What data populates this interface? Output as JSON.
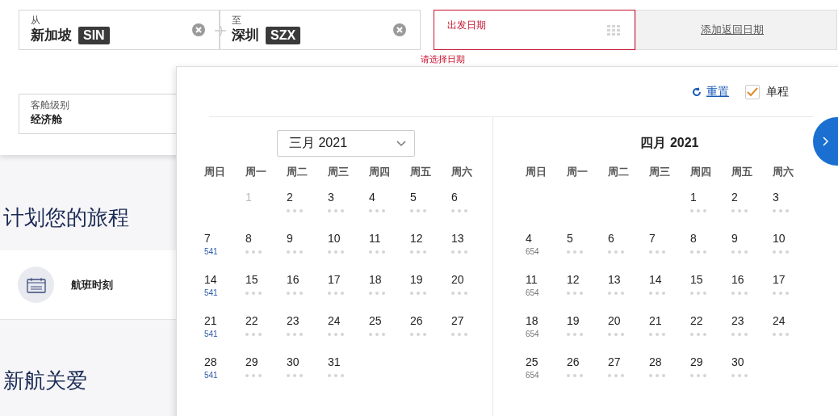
{
  "trip_form": {
    "origin": {
      "label": "从",
      "city": "新加坡",
      "code": "SIN"
    },
    "destination": {
      "label": "至",
      "city": "深圳",
      "code": "SZX"
    },
    "depart": {
      "label": "出发日期",
      "invalid": true,
      "error": "请选择日期"
    },
    "return": {
      "label": "添加返回日期"
    },
    "cabin": {
      "label": "客舱级别",
      "value": "经济舱"
    }
  },
  "sidebar": {
    "title": "计划您的旅程",
    "items": [
      {
        "label": "航班时刻"
      }
    ],
    "section_title": "新航关爱"
  },
  "calendar": {
    "reset": "重置",
    "one_way": {
      "label": "单程",
      "checked": true
    },
    "months": [
      {
        "kind": "dropdown",
        "title": "三月 2021",
        "weekdays": [
          "周日",
          "周一",
          "周二",
          "周三",
          "周四",
          "周五",
          "周六"
        ],
        "weeks": [
          [
            {
              "kind": "empty"
            },
            {
              "day": "1",
              "disabled": true
            },
            {
              "day": "2",
              "disabled": false
            },
            {
              "day": "3",
              "disabled": false
            },
            {
              "day": "4",
              "disabled": false
            },
            {
              "day": "5",
              "disabled": false
            },
            {
              "day": "6",
              "disabled": false
            }
          ],
          [
            {
              "day": "7",
              "disabled": false,
              "fare": "541",
              "highlight": true
            },
            {
              "day": "8",
              "disabled": false
            },
            {
              "day": "9",
              "disabled": false
            },
            {
              "day": "10",
              "disabled": false
            },
            {
              "day": "11",
              "disabled": false
            },
            {
              "day": "12",
              "disabled": false
            },
            {
              "day": "13",
              "disabled": false
            }
          ],
          [
            {
              "day": "14",
              "disabled": false,
              "fare": "541",
              "highlight": true
            },
            {
              "day": "15",
              "disabled": false
            },
            {
              "day": "16",
              "disabled": false
            },
            {
              "day": "17",
              "disabled": false
            },
            {
              "day": "18",
              "disabled": false
            },
            {
              "day": "19",
              "disabled": false
            },
            {
              "day": "20",
              "disabled": false
            }
          ],
          [
            {
              "day": "21",
              "disabled": false,
              "fare": "541",
              "highlight": true
            },
            {
              "day": "22",
              "disabled": false
            },
            {
              "day": "23",
              "disabled": false
            },
            {
              "day": "24",
              "disabled": false
            },
            {
              "day": "25",
              "disabled": false
            },
            {
              "day": "26",
              "disabled": false
            },
            {
              "day": "27",
              "disabled": false
            }
          ],
          [
            {
              "day": "28",
              "disabled": false,
              "fare": "541",
              "highlight": true
            },
            {
              "day": "29",
              "disabled": false
            },
            {
              "day": "30",
              "disabled": false
            },
            {
              "day": "31",
              "disabled": false
            },
            {
              "kind": "empty"
            },
            {
              "kind": "empty"
            },
            {
              "kind": "empty"
            }
          ]
        ]
      },
      {
        "kind": "title",
        "title": "四月 2021",
        "weekdays": [
          "周日",
          "周一",
          "周二",
          "周三",
          "周四",
          "周五",
          "周六"
        ],
        "weeks": [
          [
            {
              "kind": "empty"
            },
            {
              "kind": "empty"
            },
            {
              "kind": "empty"
            },
            {
              "kind": "empty"
            },
            {
              "day": "1",
              "disabled": false
            },
            {
              "day": "2",
              "disabled": false
            },
            {
              "day": "3",
              "disabled": false
            }
          ],
          [
            {
              "day": "4",
              "disabled": false,
              "fare": "654",
              "highlight": false
            },
            {
              "day": "5",
              "disabled": false
            },
            {
              "day": "6",
              "disabled": false
            },
            {
              "day": "7",
              "disabled": false
            },
            {
              "day": "8",
              "disabled": false
            },
            {
              "day": "9",
              "disabled": false
            },
            {
              "day": "10",
              "disabled": false
            }
          ],
          [
            {
              "day": "11",
              "disabled": false,
              "fare": "654",
              "highlight": false
            },
            {
              "day": "12",
              "disabled": false
            },
            {
              "day": "13",
              "disabled": false
            },
            {
              "day": "14",
              "disabled": false
            },
            {
              "day": "15",
              "disabled": false
            },
            {
              "day": "16",
              "disabled": false
            },
            {
              "day": "17",
              "disabled": false
            }
          ],
          [
            {
              "day": "18",
              "disabled": false,
              "fare": "654",
              "highlight": false
            },
            {
              "day": "19",
              "disabled": false
            },
            {
              "day": "20",
              "disabled": false
            },
            {
              "day": "21",
              "disabled": false
            },
            {
              "day": "22",
              "disabled": false
            },
            {
              "day": "23",
              "disabled": false
            },
            {
              "day": "24",
              "disabled": false
            }
          ],
          [
            {
              "day": "25",
              "disabled": false,
              "fare": "654",
              "highlight": false
            },
            {
              "day": "26",
              "disabled": false
            },
            {
              "day": "27",
              "disabled": false
            },
            {
              "day": "28",
              "disabled": false
            },
            {
              "day": "29",
              "disabled": false
            },
            {
              "day": "30",
              "disabled": false
            },
            {
              "kind": "empty"
            }
          ]
        ]
      }
    ]
  }
}
